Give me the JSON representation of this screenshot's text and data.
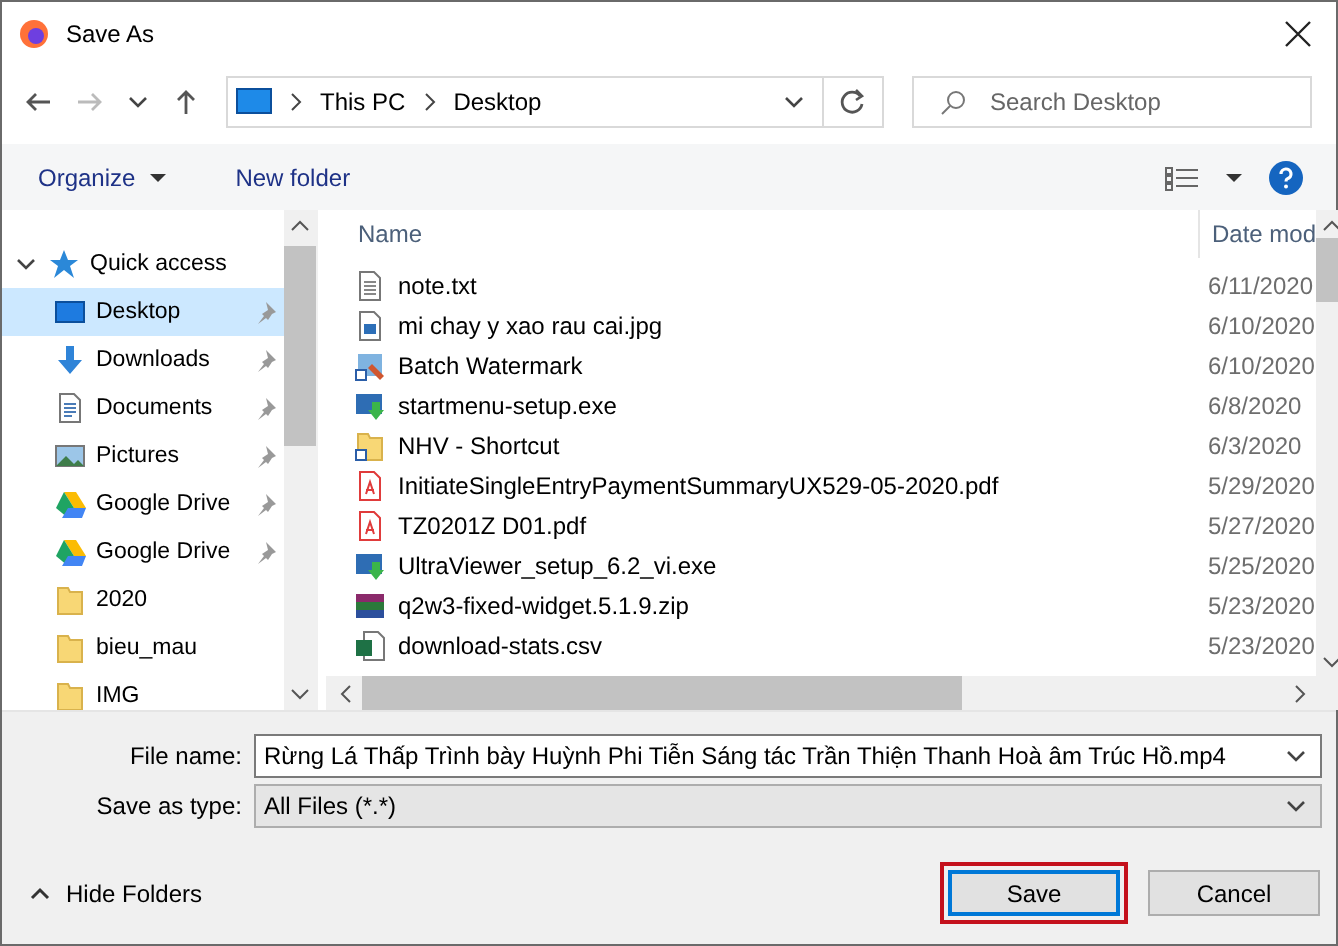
{
  "window": {
    "title": "Save As"
  },
  "address": {
    "path": [
      "This PC",
      "Desktop"
    ]
  },
  "search": {
    "placeholder": "Search Desktop"
  },
  "toolbar": {
    "organize": "Organize",
    "new_folder": "New folder"
  },
  "sidebar": {
    "items": [
      {
        "label": "Quick access",
        "kind": "star",
        "expanded": true,
        "selected": false,
        "children": [
          {
            "label": "Desktop",
            "kind": "desktop",
            "pinned": true,
            "selected": true
          },
          {
            "label": "Downloads",
            "kind": "download",
            "pinned": true,
            "selected": false
          },
          {
            "label": "Documents",
            "kind": "document",
            "pinned": true,
            "selected": false
          },
          {
            "label": "Pictures",
            "kind": "pictures",
            "pinned": true,
            "selected": false
          },
          {
            "label": "Google Drive",
            "kind": "drive",
            "pinned": true,
            "selected": false
          },
          {
            "label": "Google Drive",
            "kind": "drive",
            "pinned": true,
            "selected": false
          },
          {
            "label": "2020",
            "kind": "folder",
            "pinned": false,
            "selected": false
          },
          {
            "label": "bieu_mau",
            "kind": "folder",
            "pinned": false,
            "selected": false
          },
          {
            "label": "IMG",
            "kind": "folder",
            "pinned": false,
            "selected": false
          }
        ]
      }
    ]
  },
  "files": {
    "columns": [
      "Name",
      "Date mod"
    ],
    "rows": [
      {
        "name": "note.txt",
        "kind": "text",
        "date": "6/11/2020"
      },
      {
        "name": "mi chay y xao rau cai.jpg",
        "kind": "image",
        "date": "6/10/2020"
      },
      {
        "name": "Batch Watermark",
        "kind": "shortcut",
        "date": "6/10/2020"
      },
      {
        "name": "startmenu-setup.exe",
        "kind": "installer",
        "date": "6/8/2020"
      },
      {
        "name": "NHV - Shortcut",
        "kind": "folder-shortcut",
        "date": "6/3/2020"
      },
      {
        "name": "InitiateSingleEntryPaymentSummaryUX529-05-2020.pdf",
        "kind": "pdf",
        "date": "5/29/2020"
      },
      {
        "name": "TZ0201Z D01.pdf",
        "kind": "pdf",
        "date": "5/27/2020"
      },
      {
        "name": "UltraViewer_setup_6.2_vi.exe",
        "kind": "installer",
        "date": "5/25/2020"
      },
      {
        "name": "q2w3-fixed-widget.5.1.9.zip",
        "kind": "archive",
        "date": "5/23/2020"
      },
      {
        "name": "download-stats.csv",
        "kind": "spreadsheet",
        "date": "5/23/2020"
      }
    ]
  },
  "form": {
    "file_name": {
      "label": "File name:",
      "value": "Rừng Lá Thấp Trình bày Huỳnh Phi Tiễn Sáng tác Trần Thiện Thanh Hoà âm Trúc Hồ.mp4"
    },
    "save_as_type": {
      "label": "Save as type:",
      "value": "All Files (*.*)"
    }
  },
  "hide_folders": "Hide Folders",
  "buttons": [
    {
      "label": "Save",
      "default": true,
      "highlighted": true
    },
    {
      "label": "Cancel",
      "default": false,
      "highlighted": false
    }
  ]
}
